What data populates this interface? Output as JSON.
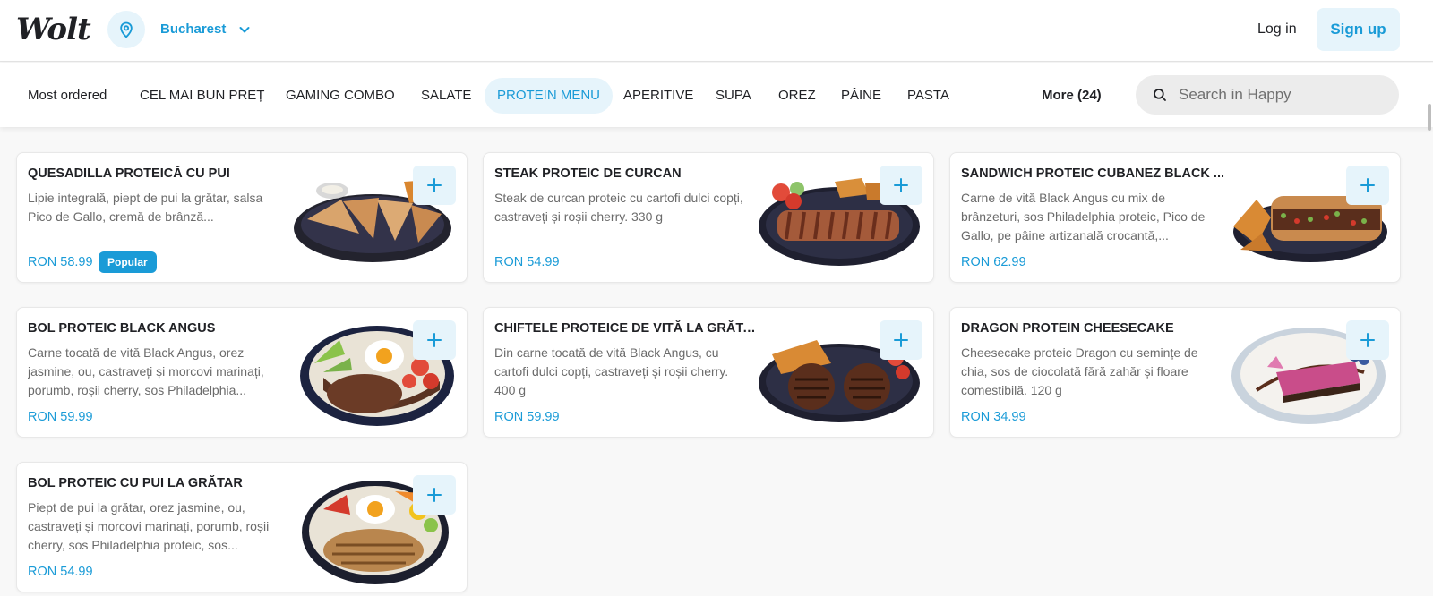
{
  "header": {
    "logo": "Wolt",
    "location_icon": "map-pin-icon",
    "city": "Bucharest",
    "login_label": "Log in",
    "signup_label": "Sign up",
    "accent_color": "#1a9bd7",
    "accent_bg": "#e6f4fb"
  },
  "categories": [
    {
      "label": "Most ordered",
      "active": false
    },
    {
      "label": "CEL MAI BUN PREȚ",
      "active": false
    },
    {
      "label": "GAMING COMBO",
      "active": false
    },
    {
      "label": "SALATE",
      "active": false
    },
    {
      "label": "PROTEIN MENU",
      "active": true
    },
    {
      "label": "APERITIVE",
      "active": false
    },
    {
      "label": "SUPA",
      "active": false
    },
    {
      "label": "OREZ",
      "active": false
    },
    {
      "label": "PÂINE",
      "active": false
    },
    {
      "label": "PASTA",
      "active": false
    }
  ],
  "more_label": "More (24)",
  "search": {
    "placeholder": "Search in Happy",
    "icon": "search-icon"
  },
  "items": [
    {
      "title": "QUESADILLA PROTEICĂ CU PUI",
      "description": "Lipie integrală, piept de pui la grătar, salsa Pico de Gallo, cremă de brânză...",
      "price": "RON 58.99",
      "badge": "Popular",
      "image": "quesadilla-plate"
    },
    {
      "title": "STEAK PROTEIC DE CURCAN",
      "description": "Steak de curcan proteic cu cartofi dulci copți, castraveți și roșii cherry. 330 g",
      "price": "RON 54.99",
      "image": "steak-plate"
    },
    {
      "title": "SANDWICH PROTEIC CUBANEZ BLACK ...",
      "description": "Carne de vită Black Angus cu mix de brânzeturi, sos Philadelphia proteic, Pico de Gallo, pe pâine artizanală crocantă,...",
      "price": "RON 62.99",
      "image": "sandwich-plate"
    },
    {
      "title": "BOL PROTEIC BLACK ANGUS",
      "description": "Carne tocată de vită Black Angus, orez jasmine, ou, castraveți și morcovi marinați, porumb, roșii cherry, sos Philadelphia...",
      "price": "RON 59.99",
      "image": "bowl-plate"
    },
    {
      "title": "CHIFTELE PROTEICE DE VITĂ LA GRĂTAR",
      "description": "Din carne tocată de vită Black Angus, cu cartofi dulci copți, castraveți și roșii cherry. 400 g",
      "price": "RON 59.99",
      "image": "patties-plate"
    },
    {
      "title": "DRAGON PROTEIN CHEESECAKE",
      "description": "Cheesecake proteic Dragon cu semințe de chia, sos de ciocolată fără zahăr și floare comestibilă. 120 g",
      "price": "RON 34.99",
      "image": "cheesecake-plate"
    },
    {
      "title": "BOL PROTEIC CU PUI LA GRĂTAR",
      "description": "Piept de pui la grătar, orez jasmine, ou, castraveți și morcovi marinați, porumb, roșii cherry, sos Philadelphia proteic, sos...",
      "price": "RON 54.99",
      "image": "chicken-bowl-plate"
    }
  ]
}
